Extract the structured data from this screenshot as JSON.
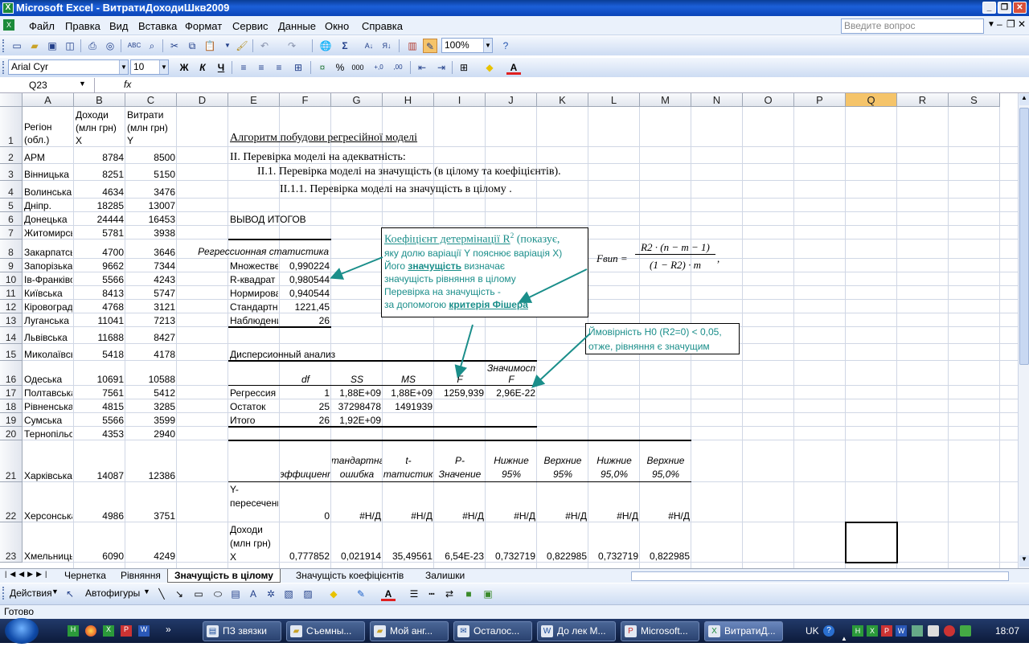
{
  "window": {
    "title": "Microsoft Excel - ВитратиДоходиШкв2009",
    "app_icon": "excel-icon"
  },
  "menu": {
    "items": [
      "Файл",
      "Правка",
      "Вид",
      "Вставка",
      "Формат",
      "Сервис",
      "Данные",
      "Окно",
      "Справка"
    ],
    "help_placeholder": "Введите вопрос"
  },
  "standard_toolbar": {
    "zoom": "100%"
  },
  "formatting_toolbar": {
    "font": "Arial Cyr",
    "size": "10",
    "bold": "Ж",
    "italic": "К",
    "underline": "Ч",
    "percent": "%",
    "thousands": "000"
  },
  "formula_bar": {
    "name_box": "Q23",
    "fx": "fx",
    "formula": ""
  },
  "columns": [
    "A",
    "B",
    "C",
    "D",
    "E",
    "F",
    "G",
    "H",
    "I",
    "J",
    "K",
    "L",
    "M",
    "N",
    "O",
    "P",
    "Q",
    "R",
    "S"
  ],
  "selected_column": "Q",
  "rows": [
    "1",
    "2",
    "3",
    "4",
    "5",
    "6",
    "7",
    "8",
    "9",
    "10",
    "11",
    "12",
    "13",
    "14",
    "15",
    "16",
    "17",
    "18",
    "19",
    "20",
    "21",
    "22",
    "23"
  ],
  "header_row": {
    "region": "Регіон (обл.)",
    "income": "Доходи (млн грн) X",
    "expense": "Витрати (млн грн) Y"
  },
  "regions": [
    {
      "name": "АРМ",
      "x": "8784",
      "y": "8500"
    },
    {
      "name": "Вінницька",
      "x": "8251",
      "y": "5150"
    },
    {
      "name": "Волинська",
      "x": "4634",
      "y": "3476"
    },
    {
      "name": "Дніпр.",
      "x": "18285",
      "y": "13007"
    },
    {
      "name": "Донецька",
      "x": "24444",
      "y": "16453"
    },
    {
      "name": "Житомирська",
      "x": "5781",
      "y": "3938"
    },
    {
      "name": "Закарпатська",
      "x": "4700",
      "y": "3646"
    },
    {
      "name": "Запорізька",
      "x": "9662",
      "y": "7344"
    },
    {
      "name": "Ів-Франківська",
      "x": "5566",
      "y": "4243"
    },
    {
      "name": "Київська",
      "x": "8413",
      "y": "5747"
    },
    {
      "name": "Кіровоградська",
      "x": "4768",
      "y": "3121"
    },
    {
      "name": "Луганська",
      "x": "11041",
      "y": "7213"
    },
    {
      "name": "Львівська",
      "x": "11688",
      "y": "8427"
    },
    {
      "name": "Миколаївська",
      "x": "5418",
      "y": "4178"
    },
    {
      "name": "Одеська",
      "x": "10691",
      "y": "10588"
    },
    {
      "name": "Полтавська",
      "x": "7561",
      "y": "5412"
    },
    {
      "name": "Рівненська",
      "x": "4815",
      "y": "3285"
    },
    {
      "name": "Сумська",
      "x": "5566",
      "y": "3599"
    },
    {
      "name": "Тернопільська",
      "x": "4353",
      "y": "2940"
    },
    {
      "name": "Харківська",
      "x": "14087",
      "y": "12386"
    },
    {
      "name": "Херсонська",
      "x": "4986",
      "y": "3751"
    },
    {
      "name": "Хмельницька",
      "x": "6090",
      "y": "4249"
    }
  ],
  "headings": {
    "algorithm": "Алгоритм побудови регресійної моделі",
    "section2": "ІІ. Перевірка моделі на адекватність:",
    "section21": "ІІ.1. Перевірка моделі на значущість (в цілому та коефіцієнтів).",
    "section211": "ІІ.1.1. Перевірка моделі на значущість в цілому ."
  },
  "summary": {
    "title": "ВЫВОД ИТОГОВ",
    "reg_stats_title": "Регрессионная статистика",
    "stats": [
      {
        "label": "Множественный R",
        "value": "0,990224"
      },
      {
        "label": "R-квадрат",
        "value": "0,980544"
      },
      {
        "label": "Нормированный R-квадрат",
        "value": "0,940544"
      },
      {
        "label": "Стандартная ошибка",
        "value": "1221,45"
      },
      {
        "label": "Наблюдения",
        "value": "26"
      }
    ]
  },
  "anova": {
    "title": "Дисперсионный анализ",
    "headers": {
      "df": "df",
      "ss": "SS",
      "ms": "MS",
      "f": "F",
      "sigf": "Значимость F"
    },
    "rows": [
      {
        "label": "Регрессия",
        "df": "1",
        "ss": "1,88E+09",
        "ms": "1,88E+09",
        "f": "1259,939",
        "sigf": "2,96E-22"
      },
      {
        "label": "Остаток",
        "df": "25",
        "ss": "37298478",
        "ms": "1491939",
        "f": "",
        "sigf": ""
      },
      {
        "label": "Итого",
        "df": "26",
        "ss": "1,92E+09",
        "ms": "",
        "f": "",
        "sigf": ""
      }
    ]
  },
  "coef": {
    "headers": [
      "Коэффициенты",
      "Стандартная ошибка",
      "t-статистика",
      "P-Значение",
      "Нижние 95%",
      "Верхние 95%",
      "Нижние 95,0%",
      "Верхние 95,0%"
    ],
    "rows": [
      {
        "label": "Y-пересечение",
        "values": [
          "0",
          "#Н/Д",
          "#Н/Д",
          "#Н/Д",
          "#Н/Д",
          "#Н/Д",
          "#Н/Д",
          "#Н/Д"
        ]
      },
      {
        "label": "Доходи (млн грн) X",
        "values": [
          "0,777852",
          "0,021914",
          "35,49561",
          "6,54E-23",
          "0,732719",
          "0,822985",
          "0,732719",
          "0,822985"
        ]
      }
    ]
  },
  "note_r2": {
    "title_a": "Коефіцієнт детермінації R",
    "sup": "2",
    "title_b": " (показує,",
    "line2": "яку долю варіації Y пояснює варіація X)",
    "line3a": "Його ",
    "line3b": "значущість",
    "line3c": " визначає",
    "line4": "значущість рівняння в цілому",
    "line5": "Перевірка на значущість -",
    "line6a": "за допомогою ",
    "line6b": "критерія Фішера"
  },
  "note_prob": {
    "line1": "Ймовірність H0 (R2=0) < 0,05,",
    "line2": "отже, рівняння є значущим"
  },
  "formula": {
    "lhs": "Fвип =",
    "num": "R2 · (n − m − 1)",
    "den": "(1 − R2) · m",
    "trail": ","
  },
  "sheet_tabs": [
    "Чернетка",
    "Рівняння",
    "Значущість в цілому",
    "Значущість коефіцієнтів",
    "Залишки"
  ],
  "active_tab": "Значущість в цілому",
  "draw_toolbar": {
    "actions": "Действия",
    "autoshapes": "Автофигуры"
  },
  "status": "Готово",
  "taskbar": {
    "tasks": [
      "ПЗ звязки",
      "Съемны...",
      "Мой анг...",
      "Осталос...",
      "До лек М...",
      "Microsoft...",
      "ВитратиД..."
    ],
    "lang": "UK",
    "time": "18:07"
  }
}
